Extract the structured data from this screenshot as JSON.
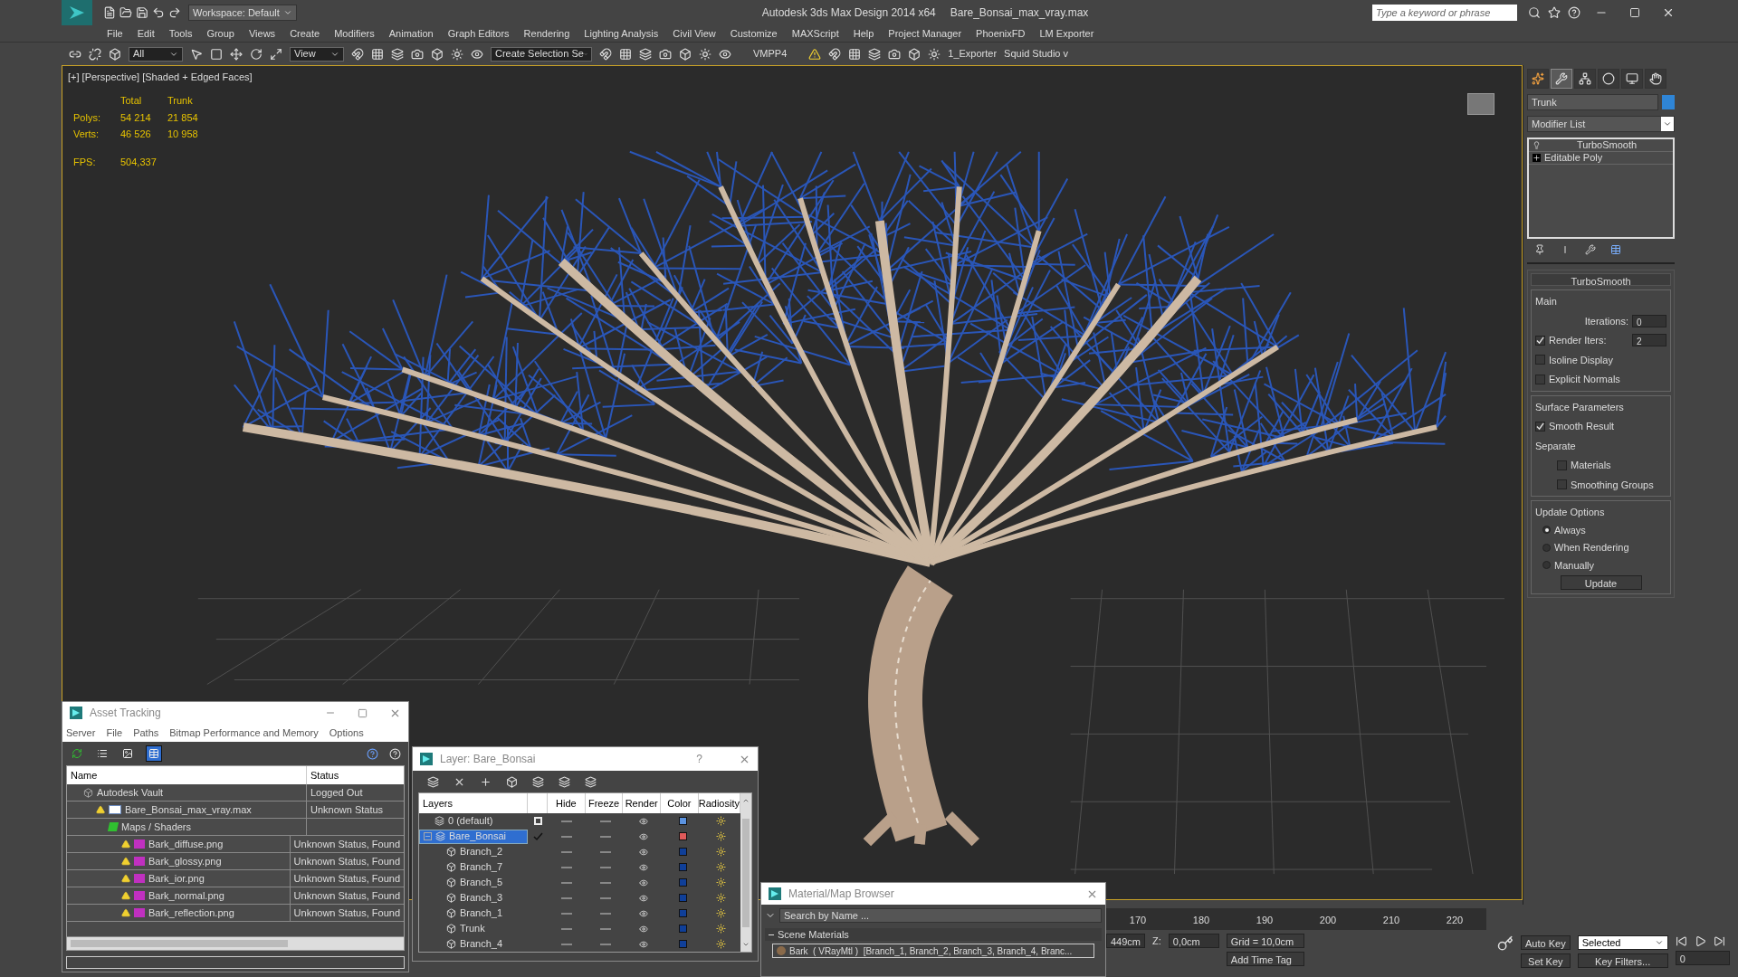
{
  "title_bar": {
    "workspace": "Workspace: Default",
    "title": "Autodesk 3ds Max Design 2014 x64",
    "filename": "Bare_Bonsai_max_vray.max",
    "search_placeholder": "Type a keyword or phrase"
  },
  "menu": [
    "File",
    "Edit",
    "Tools",
    "Group",
    "Views",
    "Create",
    "Modifiers",
    "Animation",
    "Graph Editors",
    "Rendering",
    "Lighting Analysis",
    "Civil View",
    "Customize",
    "MAXScript",
    "Help",
    "Project Manager",
    "PhoenixFD",
    "LM Exporter"
  ],
  "toolbar": {
    "selection_filter": "All",
    "reference_coord": "View",
    "named_selection": "Create Selection Se",
    "plugin_label": "VMPP4",
    "exporter_label": "1_Exporter",
    "studio_label": "Squid Studio v"
  },
  "viewport": {
    "label": "[+] [Perspective] [Shaded + Edged Faces]",
    "stats": {
      "headers": [
        "Total",
        "Trunk"
      ],
      "rows": [
        {
          "label": "Polys:",
          "values": [
            "54 214",
            "21 854"
          ]
        },
        {
          "label": "Verts:",
          "values": [
            "46 526",
            "10 958"
          ]
        }
      ],
      "fps_label": "FPS:",
      "fps_value": "504,337"
    }
  },
  "command_panel": {
    "tabs": [
      {
        "selected": false
      },
      {
        "selected": true
      },
      {
        "selected": false
      },
      {
        "selected": false
      },
      {
        "selected": false
      },
      {
        "selected": false
      }
    ],
    "object_name": "Trunk",
    "modifier_list": "Modifier List",
    "stack": [
      {
        "label": "TurboSmooth",
        "kind": "modifier"
      },
      {
        "label": "Editable Poly",
        "kind": "base"
      }
    ],
    "rollout": {
      "title": "TurboSmooth",
      "main_group": "Main",
      "iterations_label": "Iterations:",
      "iterations_value": "0",
      "render_iters_label": "Render Iters:",
      "render_iters_value": "2",
      "render_iters_checked": true,
      "main_checks": [
        {
          "label": "Isoline Display",
          "checked": false
        },
        {
          "label": "Explicit Normals",
          "checked": false
        }
      ],
      "surface_group": "Surface Parameters",
      "smooth_result": {
        "label": "Smooth Result",
        "checked": true
      },
      "separate_label": "Separate",
      "separate_checks": [
        {
          "label": "Materials",
          "checked": false
        },
        {
          "label": "Smoothing Groups",
          "checked": false
        }
      ],
      "update_group": "Update Options",
      "update_radios": [
        {
          "label": "Always",
          "selected": true
        },
        {
          "label": "When Rendering",
          "selected": false
        },
        {
          "label": "Manually",
          "selected": false
        }
      ],
      "update_button": "Update"
    }
  },
  "asset_tracking": {
    "title": "Asset Tracking",
    "menu": [
      "Server",
      "File",
      "Paths",
      "Bitmap Performance and Memory",
      "Options"
    ],
    "view_buttons": [
      {
        "selected": false
      },
      {
        "selected": false
      },
      {
        "selected": false
      },
      {
        "selected": true
      }
    ],
    "columns": [
      "Name",
      "Status"
    ],
    "rows": [
      {
        "name": "Autodesk Vault",
        "kind": "vault",
        "status": "Logged Out",
        "children": [
          {
            "name": "Bare_Bonsai_max_vray.max",
            "kind": "scene",
            "status": "Unknown Status",
            "children": [
              {
                "name": "Maps / Shaders",
                "kind": "folder",
                "children": [
                  {
                    "name": "Bark_diffuse.png",
                    "kind": "bitmap",
                    "status": "Unknown Status, Found"
                  },
                  {
                    "name": "Bark_glossy.png",
                    "kind": "bitmap",
                    "status": "Unknown Status, Found"
                  },
                  {
                    "name": "Bark_ior.png",
                    "kind": "bitmap",
                    "status": "Unknown Status, Found"
                  },
                  {
                    "name": "Bark_normal.png",
                    "kind": "bitmap",
                    "status": "Unknown Status, Found"
                  },
                  {
                    "name": "Bark_reflection.png",
                    "kind": "bitmap",
                    "status": "Unknown Status, Found"
                  }
                ]
              }
            ]
          }
        ]
      }
    ]
  },
  "layer_window": {
    "title": "Layer: Bare_Bonsai",
    "help": "?",
    "columns": [
      "Layers",
      "Hide",
      "Freeze",
      "Render",
      "Color",
      "Radiosity"
    ],
    "rows": [
      {
        "name": "0 (default)",
        "kind": "layer",
        "active": false,
        "selected": false,
        "color": "#5b93e0"
      },
      {
        "name": "Bare_Bonsai",
        "kind": "layer",
        "active": true,
        "selected": true,
        "expanded": true,
        "color": "#e05a5a"
      },
      {
        "name": "Branch_2",
        "kind": "object",
        "color": "#0f3f99"
      },
      {
        "name": "Branch_7",
        "kind": "object",
        "color": "#0f3f99"
      },
      {
        "name": "Branch_5",
        "kind": "object",
        "color": "#0f3f99"
      },
      {
        "name": "Branch_3",
        "kind": "object",
        "color": "#0f3f99"
      },
      {
        "name": "Branch_1",
        "kind": "object",
        "color": "#0f3f99"
      },
      {
        "name": "Trunk",
        "kind": "object",
        "color": "#0f3f99"
      },
      {
        "name": "Branch_4",
        "kind": "object",
        "color": "#0f3f99"
      }
    ]
  },
  "material_browser": {
    "title": "Material/Map Browser",
    "search_placeholder": "Search by Name ...",
    "group": "Scene Materials",
    "group_expanded": true,
    "items": [
      "Bark  ( VRayMtl )  [Branch_1, Branch_2, Branch_3, Branch_4, Branc..."
    ]
  },
  "timeline": {
    "ticks": [
      "170",
      "180",
      "190",
      "200",
      "210",
      "220"
    ]
  },
  "status": {
    "x_value": "449cm",
    "z_label": "Z:",
    "z_value": "0,0cm",
    "grid": "Grid = 10,0cm",
    "add_time_tag": "Add Time Tag",
    "auto_key": "Auto Key",
    "key_mode": "Selected",
    "set_key": "Set Key",
    "key_filters": "Key Filters...",
    "frame": "0"
  }
}
